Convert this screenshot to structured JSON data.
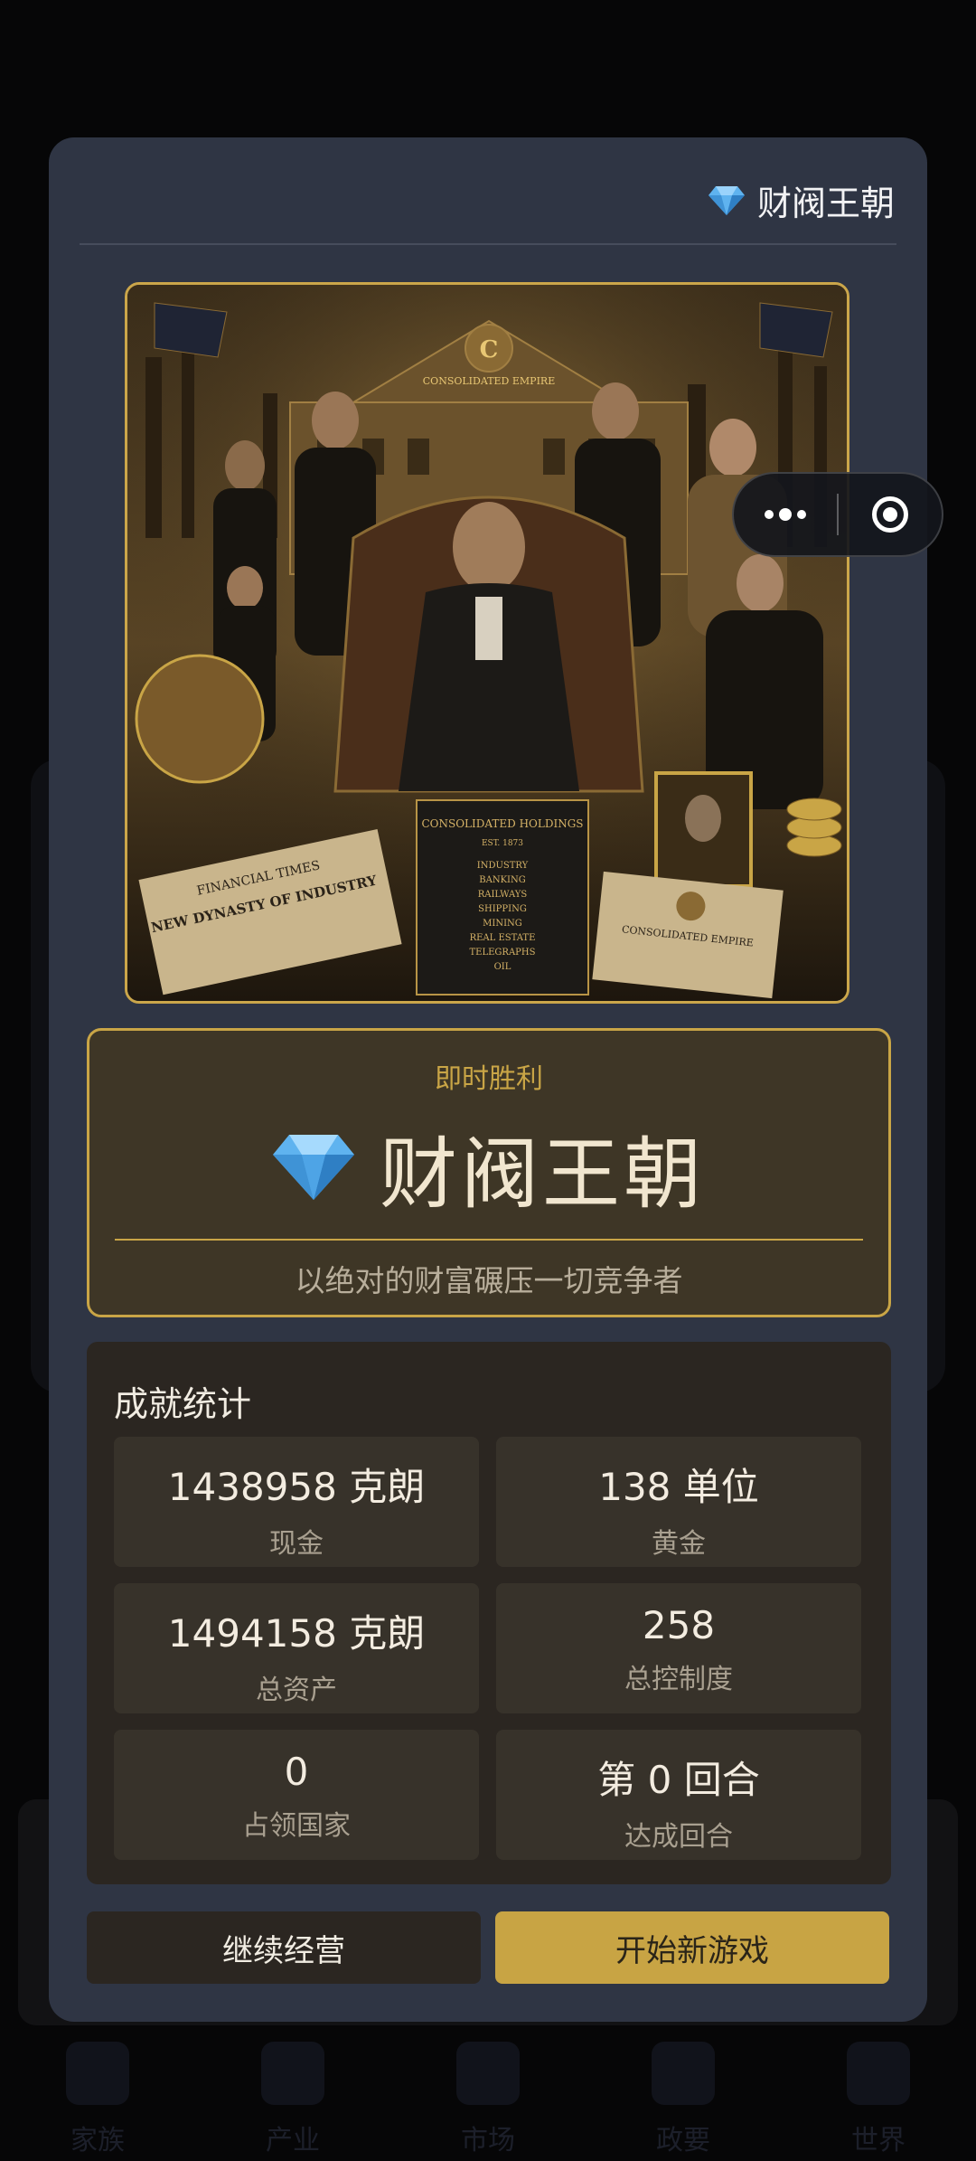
{
  "modal": {
    "header_title": "财阀王朝",
    "hero_image": {
      "book_title": "CONSOLIDATED HOLDINGS",
      "book_est": "EST. 1873",
      "book_items": [
        "INDUSTRY",
        "BANKING",
        "RAILWAYS",
        "SHIPPING",
        "MINING",
        "REAL ESTATE",
        "TELEGRAPHS",
        "OIL"
      ],
      "newspaper_header": "FINANCIAL TIMES",
      "newspaper_headline": "NEW DYNASTY OF INDUSTRY",
      "banner_text": "CONSOLIDATED EMPIRE",
      "certificate_text": "CONSOLIDATED EMPIRE"
    },
    "victory": {
      "subtitle": "即时胜利",
      "title": "财阀王朝",
      "description": "以绝对的财富碾压一切竞争者"
    },
    "stats": {
      "title": "成就统计",
      "items": [
        {
          "value": "1438958 克朗",
          "label": "现金"
        },
        {
          "value": "138 单位",
          "label": "黄金"
        },
        {
          "value": "1494158 克朗",
          "label": "总资产"
        },
        {
          "value": "258",
          "label": "总控制度"
        },
        {
          "value": "0",
          "label": "占领国家"
        },
        {
          "value": "第 0 回合",
          "label": "达成回合"
        }
      ]
    },
    "buttons": {
      "continue_label": "继续经营",
      "new_game_label": "开始新游戏"
    }
  },
  "bottom_nav": {
    "items": [
      "家族",
      "产业",
      "市场",
      "政要",
      "世界"
    ]
  },
  "colors": {
    "modal_bg": "#2f3544",
    "gold_accent": "#c9a546",
    "victory_bg": "#3e3626",
    "stats_bg": "#2b2621",
    "primary_button": "#c8a444"
  }
}
